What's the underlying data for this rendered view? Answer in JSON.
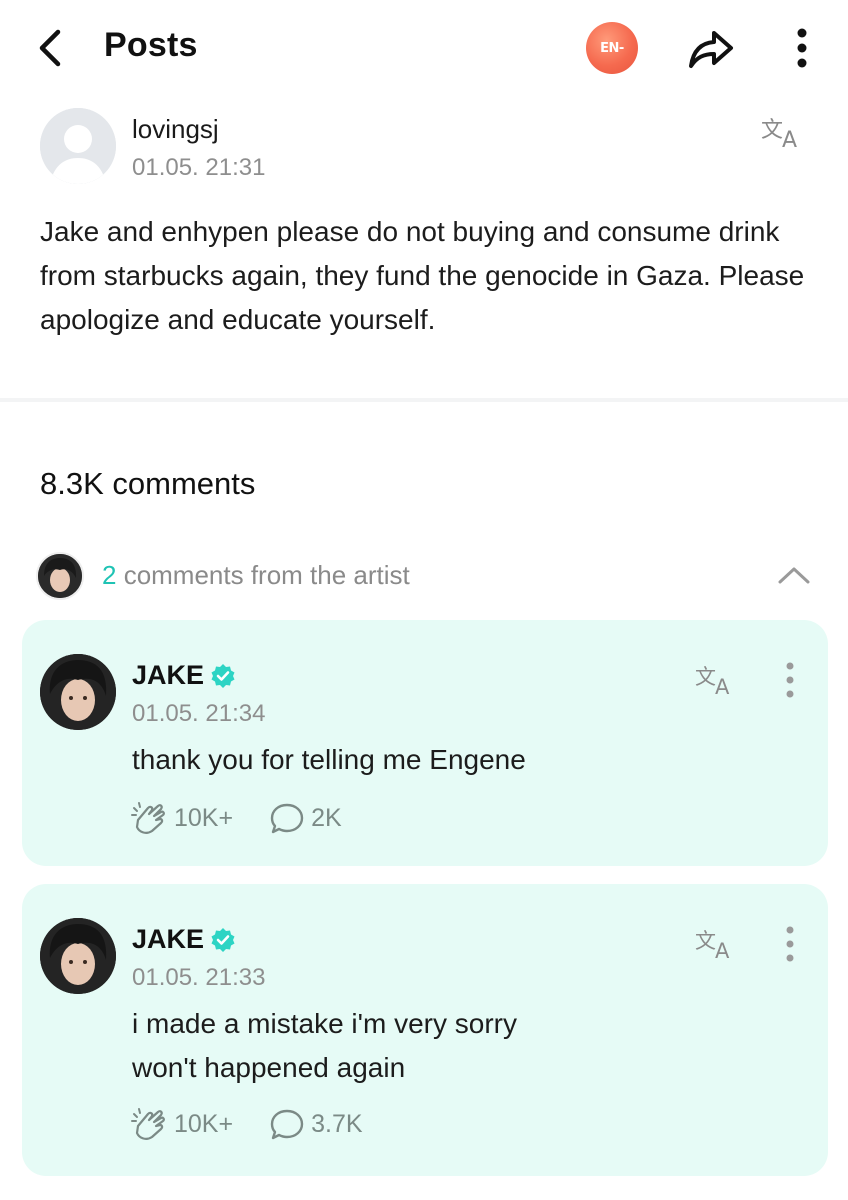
{
  "header": {
    "title": "Posts",
    "badge_label": "EN-",
    "icons": [
      "chevron-left-icon",
      "share-icon",
      "more-vertical-icon"
    ]
  },
  "post": {
    "author": "lovingsj",
    "date": "01.05. 21:31",
    "body": "Jake and enhypen please do not buying and consume drink from starbucks again, they fund the genocide in Gaza. Please apologize and educate yourself."
  },
  "comments_count": "8.3K comments",
  "artist_summary": {
    "count": "2",
    "label": " comments from the artist"
  },
  "comments": [
    {
      "name": "JAKE",
      "date": "01.05. 21:34",
      "text": "thank you for telling me Engene",
      "likes": "10K+",
      "replies": "2K"
    },
    {
      "name": "JAKE",
      "date": "01.05. 21:33",
      "text": "i made a mistake i'm very sorry\nwon't happened again",
      "likes": "10K+",
      "replies": "3.7K"
    }
  ],
  "colors": {
    "accent": "#1fc3b4",
    "card_bg": "#e6fbf6",
    "badge": "#f56a4f",
    "verified": "#2dd4c4"
  }
}
